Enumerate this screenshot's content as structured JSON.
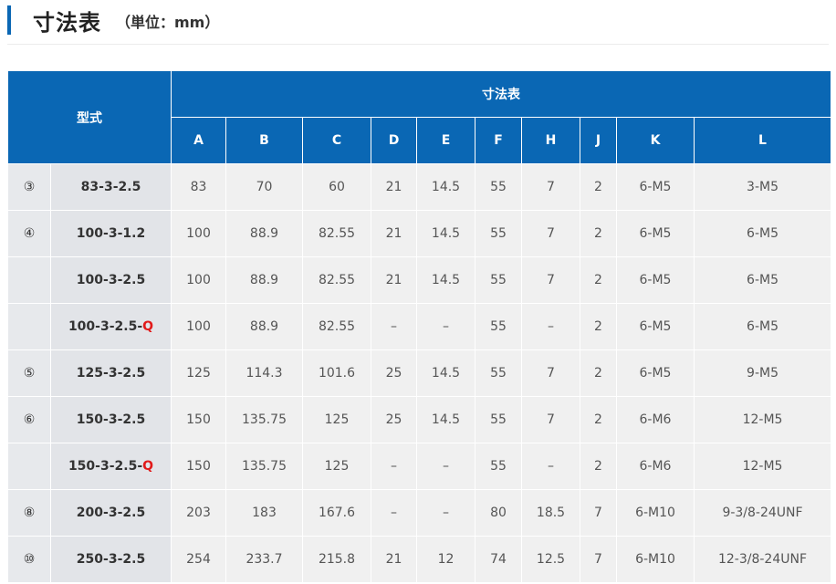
{
  "heading": {
    "title": "寸法表",
    "unit": "（単位：mm）"
  },
  "table": {
    "model_header": "型式",
    "group_header": "寸法表",
    "columns": [
      "A",
      "B",
      "C",
      "D",
      "E",
      "F",
      "H",
      "J",
      "K",
      "L"
    ],
    "rows": [
      {
        "num": "③",
        "model": "83-3-2.5",
        "suffix": "",
        "cells": [
          "83",
          "70",
          "60",
          "21",
          "14.5",
          "55",
          "7",
          "2",
          "6-M5",
          "3-M5"
        ]
      },
      {
        "num": "④",
        "model": "100-3-1.2",
        "suffix": "",
        "cells": [
          "100",
          "88.9",
          "82.55",
          "21",
          "14.5",
          "55",
          "7",
          "2",
          "6-M5",
          "6-M5"
        ]
      },
      {
        "num": "",
        "model": "100-3-2.5",
        "suffix": "",
        "cells": [
          "100",
          "88.9",
          "82.55",
          "21",
          "14.5",
          "55",
          "7",
          "2",
          "6-M5",
          "6-M5"
        ]
      },
      {
        "num": "",
        "model": "100-3-2.5-",
        "suffix": "Q",
        "cells": [
          "100",
          "88.9",
          "82.55",
          "–",
          "–",
          "55",
          "–",
          "2",
          "6-M5",
          "6-M5"
        ]
      },
      {
        "num": "⑤",
        "model": "125-3-2.5",
        "suffix": "",
        "cells": [
          "125",
          "114.3",
          "101.6",
          "25",
          "14.5",
          "55",
          "7",
          "2",
          "6-M5",
          "9-M5"
        ]
      },
      {
        "num": "⑥",
        "model": "150-3-2.5",
        "suffix": "",
        "cells": [
          "150",
          "135.75",
          "125",
          "25",
          "14.5",
          "55",
          "7",
          "2",
          "6-M6",
          "12-M5"
        ]
      },
      {
        "num": "",
        "model": "150-3-2.5-",
        "suffix": "Q",
        "cells": [
          "150",
          "135.75",
          "125",
          "–",
          "–",
          "55",
          "–",
          "2",
          "6-M6",
          "12-M5"
        ]
      },
      {
        "num": "⑧",
        "model": "200-3-2.5",
        "suffix": "",
        "cells": [
          "203",
          "183",
          "167.6",
          "–",
          "–",
          "80",
          "18.5",
          "7",
          "6-M10",
          "9-3/8-24UNF"
        ]
      },
      {
        "num": "⑩",
        "model": "250-3-2.5",
        "suffix": "",
        "cells": [
          "254",
          "233.7",
          "215.8",
          "21",
          "12",
          "74",
          "12.5",
          "7",
          "6-M10",
          "12-3/8-24UNF"
        ]
      }
    ]
  }
}
